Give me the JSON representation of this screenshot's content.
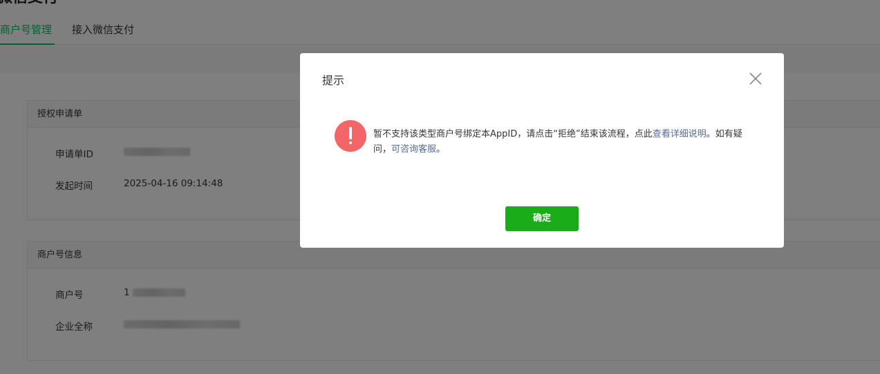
{
  "page": {
    "title": "微信支付"
  },
  "tabs": [
    {
      "label": "商户号管理",
      "active": true
    },
    {
      "label": "接入微信支付",
      "active": false
    }
  ],
  "auth_section": {
    "header": "授权申请单",
    "rows": [
      {
        "label": "申请单ID",
        "value": ""
      },
      {
        "label": "发起时间",
        "value": "2025-04-16 09:14:48"
      }
    ]
  },
  "merchant_section": {
    "header": "商户号信息",
    "rows": [
      {
        "label": "商户号",
        "value": "1"
      },
      {
        "label": "企业全称",
        "value": ""
      }
    ]
  },
  "dialog": {
    "title": "提示",
    "message_part1": "暂不支持该类型商户号绑定本AppID，请点击“拒绝”结束该流程，点此",
    "link1": "查看详细说明",
    "message_part2": "。如有疑问，",
    "link2": "可咨询客服",
    "message_part3": "。",
    "ok_button": "确定"
  },
  "colors": {
    "accent_green": "#07c160",
    "button_green": "#1aad19",
    "warning_red": "#f2666a",
    "link_blue": "#576b95"
  },
  "icons": {
    "close": "close-icon",
    "warning": "warning-icon"
  }
}
